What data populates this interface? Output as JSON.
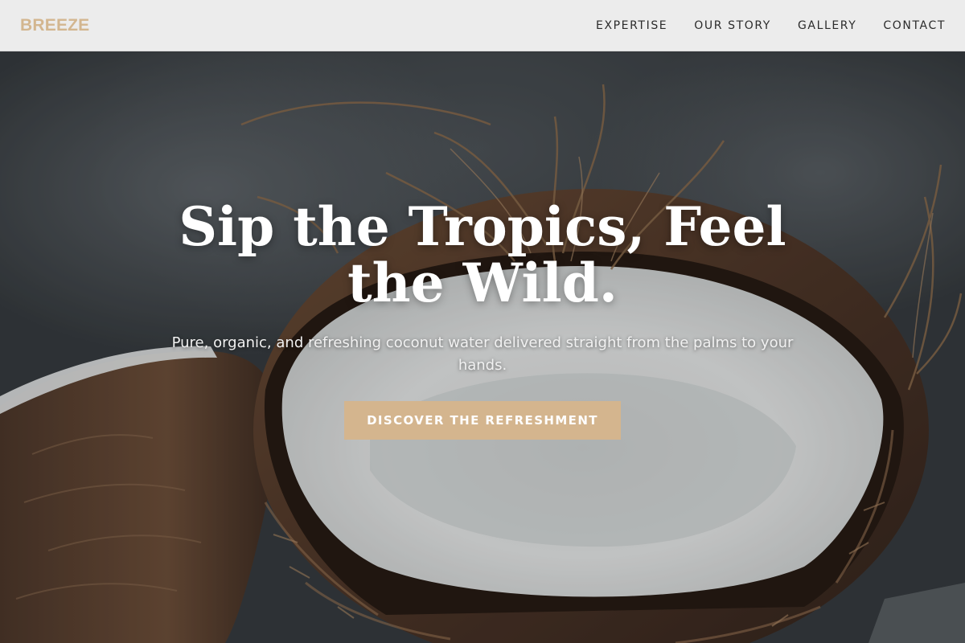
{
  "header": {
    "brand": "BREEZE",
    "nav": [
      {
        "label": "EXPERTISE"
      },
      {
        "label": "OUR STORY"
      },
      {
        "label": "GALLERY"
      },
      {
        "label": "CONTACT"
      }
    ]
  },
  "hero": {
    "title": "Sip the Tropics, Feel the Wild.",
    "subtitle": "Pure, organic, and refreshing coconut water delivered straight from the palms to your hands.",
    "cta_label": "DISCOVER THE REFRESHMENT",
    "image": "coconut-halves-photo"
  },
  "colors": {
    "accent": "#d4b58e",
    "brand": "#d3b68f",
    "header_bg": "#ececec",
    "nav_text": "#2b2b2b"
  }
}
